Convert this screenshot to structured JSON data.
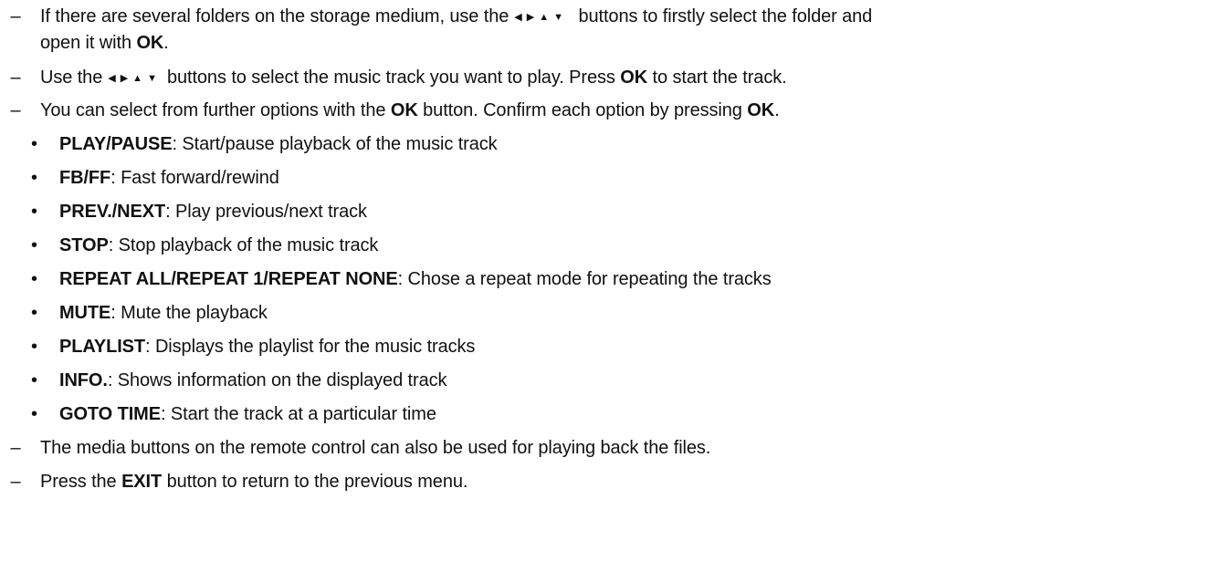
{
  "dash_symbol": "–",
  "bullet_symbol": "•",
  "arrow_icons": [
    "triangle-left-icon",
    "triangle-right-icon",
    "triangle-up-icon",
    "triangle-down-icon"
  ],
  "instructions": [
    {
      "before": "If there are several folders on the storage medium, use the",
      "after": "buttons to firstly select the folder and",
      "line2_before": "open it with",
      "line2_key": "OK",
      "line2_after": "."
    },
    {
      "before": "Use the",
      "after_before_key": "buttons to select the music track you want to play. Press",
      "key": "OK",
      "after": "to start the track."
    },
    {
      "before": "You can select from further options with the",
      "key1": "OK",
      "mid": "button. Confirm each option by pressing",
      "key2": "OK",
      "after": "."
    }
  ],
  "options": [
    {
      "key": "PLAY/PAUSE",
      "desc": ": Start/pause playback of the music track"
    },
    {
      "key": "FB/FF",
      "desc": ": Fast forward/rewind"
    },
    {
      "key": "PREV./NEXT",
      "desc": ": Play previous/next track"
    },
    {
      "key": "STOP",
      "desc": ": Stop playback of the music track"
    },
    {
      "key": "REPEAT ALL/REPEAT 1/REPEAT NONE",
      "desc": ": Chose a repeat mode for repeating the tracks"
    },
    {
      "key": "MUTE",
      "desc": ": Mute the playback"
    },
    {
      "key": "PLAYLIST",
      "desc": ": Displays the playlist for the music tracks"
    },
    {
      "key": "INFO.",
      "desc": ": Shows information on the displayed track"
    },
    {
      "key": "GOTO TIME",
      "desc": ": Start the track at a particular time"
    }
  ],
  "closing": [
    {
      "text": "The media buttons on the remote control can also be used for playing back the files."
    },
    {
      "before": "Press the",
      "key": "EXIT",
      "after": "button to return to the previous menu."
    }
  ]
}
